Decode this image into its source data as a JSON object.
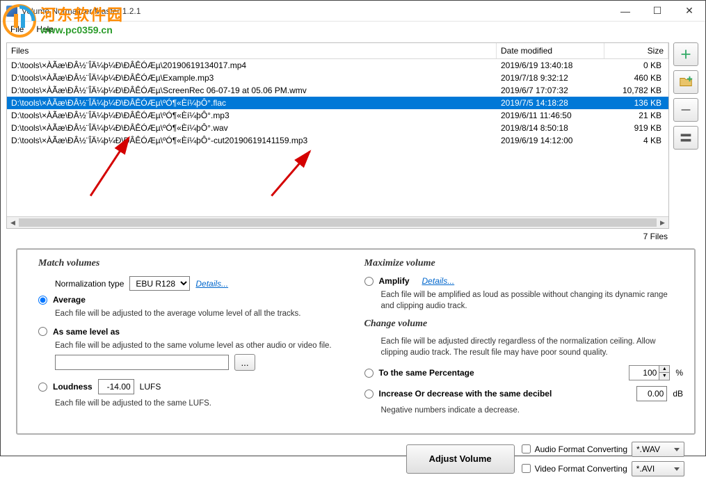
{
  "window": {
    "title": "Volume Normalizer Master 1.2.1"
  },
  "menu": {
    "file": "File",
    "help": "Help"
  },
  "watermark": {
    "cn": "河东软件园",
    "url": "www.pc0359.cn"
  },
  "columns": {
    "files": "Files",
    "date": "Date modified",
    "size": "Size"
  },
  "rows": [
    {
      "file": "D:\\tools\\×ÀÃæ\\ÐÂ½¨ÎÄ¼þ¼Ð\\ÐÂÊÓÆµ\\20190619134017.mp4",
      "date": "2019/6/19 13:40:18",
      "size": "0 KB",
      "selected": false
    },
    {
      "file": "D:\\tools\\×ÀÃæ\\ÐÂ½¨ÎÄ¼þ¼Ð\\ÐÂÊÓÆµ\\Example.mp3",
      "date": "2019/7/18 9:32:12",
      "size": "460 KB",
      "selected": false
    },
    {
      "file": "D:\\tools\\×ÀÃæ\\ÐÂ½¨ÎÄ¼þ¼Ð\\ÐÂÊÓÆµ\\ScreenRec 06-07-19 at 05.06 PM.wmv",
      "date": "2019/6/7 17:07:32",
      "size": "10,782 KB",
      "selected": false
    },
    {
      "file": "D:\\tools\\×ÀÃæ\\ÐÂ½¨ÎÄ¼þ¼Ð\\ÐÂÊÓÆµ\\ºÓ¶«Èí¼þÔ°.flac",
      "date": "2019/7/5 14:18:28",
      "size": "136 KB",
      "selected": true
    },
    {
      "file": "D:\\tools\\×ÀÃæ\\ÐÂ½¨ÎÄ¼þ¼Ð\\ÐÂÊÓÆµ\\ºÓ¶«Èí¼þÔ°.mp3",
      "date": "2019/6/11 11:46:50",
      "size": "21 KB",
      "selected": false
    },
    {
      "file": "D:\\tools\\×ÀÃæ\\ÐÂ½¨ÎÄ¼þ¼Ð\\ÐÂÊÓÆµ\\ºÓ¶«Èí¼þÔ°.wav",
      "date": "2019/8/14 8:50:18",
      "size": "919 KB",
      "selected": false
    },
    {
      "file": "D:\\tools\\×ÀÃæ\\ÐÂ½¨ÎÄ¼þ¼Ð\\ÐÂÊÓÆµ\\ºÓ¶«Èí¼þÔ°-cut20190619141159.mp3",
      "date": "2019/6/19 14:12:00",
      "size": "4 KB",
      "selected": false
    }
  ],
  "file_count": "7 Files",
  "match": {
    "title": "Match volumes",
    "norm_label": "Normalization type",
    "norm_value": "EBU R128",
    "details": "Details...",
    "avg_label": "Average",
    "avg_desc": "Each file will be adjusted to the average volume level of all the tracks.",
    "same_label": "As same level as",
    "same_desc": "Each file will be adjusted to the same volume level as other audio or video file.",
    "browse": "...",
    "loud_label": "Loudness",
    "loud_value": "-14.00",
    "loud_unit": "LUFS",
    "loud_desc": "Each file will be adjusted to the same LUFS."
  },
  "max": {
    "title": "Maximize volume",
    "amp_label": "Amplify",
    "amp_details": "Details...",
    "amp_desc": "Each file will be amplified as loud as possible without changing its dynamic range and clipping audio track."
  },
  "change": {
    "title": "Change volume",
    "desc": "Each file will be adjusted directly regardless of the normalization ceiling. Allow clipping audio track. The result file may have poor sound quality.",
    "pct_label": "To the same Percentage",
    "pct_value": "100",
    "pct_unit": "%",
    "db_label": "Increase Or decrease with the same decibel",
    "db_value": "0.00",
    "db_unit": "dB",
    "db_note": "Negative numbers indicate a decrease."
  },
  "bottom": {
    "adjust": "Adjust Volume",
    "audio_fmt": "Audio Format Converting",
    "audio_val": "*.WAV",
    "video_fmt": "Video Format Converting",
    "video_val": "*.AVI"
  }
}
